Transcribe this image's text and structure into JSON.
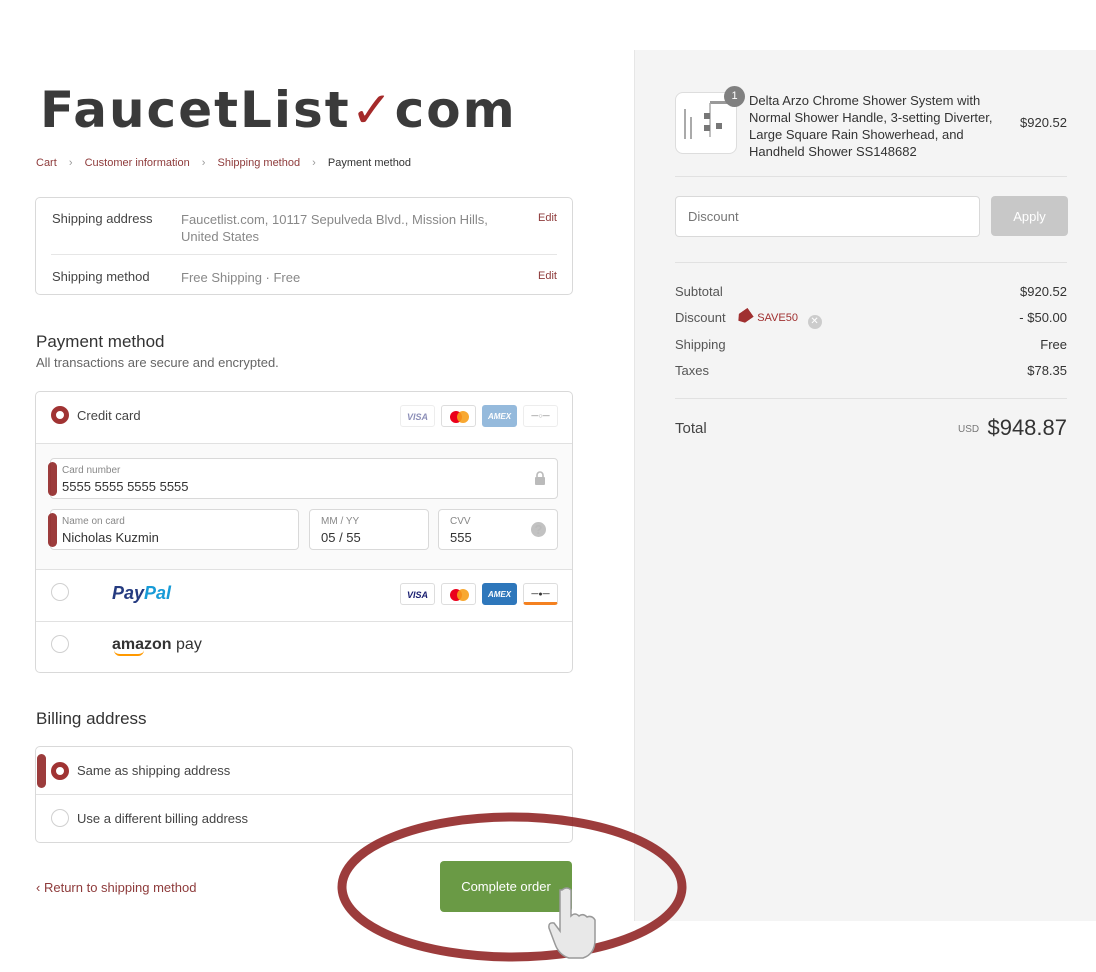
{
  "brand": {
    "logo_text_a": "FaucetList",
    "logo_check": "✓",
    "logo_text_b": "com"
  },
  "breadcrumb": {
    "items": [
      "Cart",
      "Customer information",
      "Shipping method",
      "Payment method"
    ],
    "separator": "›"
  },
  "review": {
    "shipping_address_label": "Shipping address",
    "shipping_address_value": "Faucetlist.com, 10117 Sepulveda Blvd., Mission Hills, United States",
    "shipping_method_label": "Shipping method",
    "shipping_method_value": "Free Shipping · Free",
    "edit_label": "Edit"
  },
  "payment": {
    "title": "Payment method",
    "subtitle": "All transactions are secure and encrypted.",
    "credit_card_label": "Credit card",
    "card_brands": [
      "VISA",
      "mastercard",
      "AMEX",
      "discover"
    ],
    "card_number": {
      "label": "Card number",
      "value": "5555 5555 5555 5555"
    },
    "name_on_card": {
      "label": "Name on card",
      "value": "Nicholas Kuzmin"
    },
    "expiry": {
      "label": "MM / YY",
      "value": "05 / 55"
    },
    "cvv": {
      "label": "CVV",
      "value": "555"
    },
    "paypal_label_a": "Pay",
    "paypal_label_b": "Pal",
    "amazon_label_a": "amazon",
    "amazon_label_b": " pay",
    "selected": "credit_card"
  },
  "billing": {
    "title": "Billing address",
    "same_label": "Same as shipping address",
    "different_label": "Use a different billing address",
    "selected": "same"
  },
  "actions": {
    "return_label": "Return to shipping method",
    "return_chevron": "‹",
    "complete_label": "Complete order"
  },
  "order": {
    "product_name": "Delta Arzo Chrome Shower System with Normal Shower Handle, 3-setting Diverter, Large Square Rain Showerhead, and Handheld Shower SS148682",
    "product_price": "$920.52",
    "quantity": "1",
    "discount_placeholder": "Discount",
    "apply_label": "Apply",
    "subtotal_label": "Subtotal",
    "subtotal_value": "$920.52",
    "discount_label": "Discount",
    "discount_code": "SAVE50",
    "discount_value": "- $50.00",
    "shipping_label": "Shipping",
    "shipping_value": "Free",
    "taxes_label": "Taxes",
    "taxes_value": "$78.35",
    "total_label": "Total",
    "currency": "USD",
    "total_value": "$948.87"
  },
  "colors": {
    "accent": "#8e3b3b",
    "radio_selected": "#a03333",
    "complete_button": "#6a9a45",
    "sidebar_bg": "#f4f4f4",
    "annotation": "#8b1a1a"
  },
  "icons": [
    "lock-icon",
    "help-icon",
    "tag-icon",
    "remove-icon",
    "pointing-hand-icon",
    "chevron-right-icon",
    "chevron-left-icon"
  ]
}
